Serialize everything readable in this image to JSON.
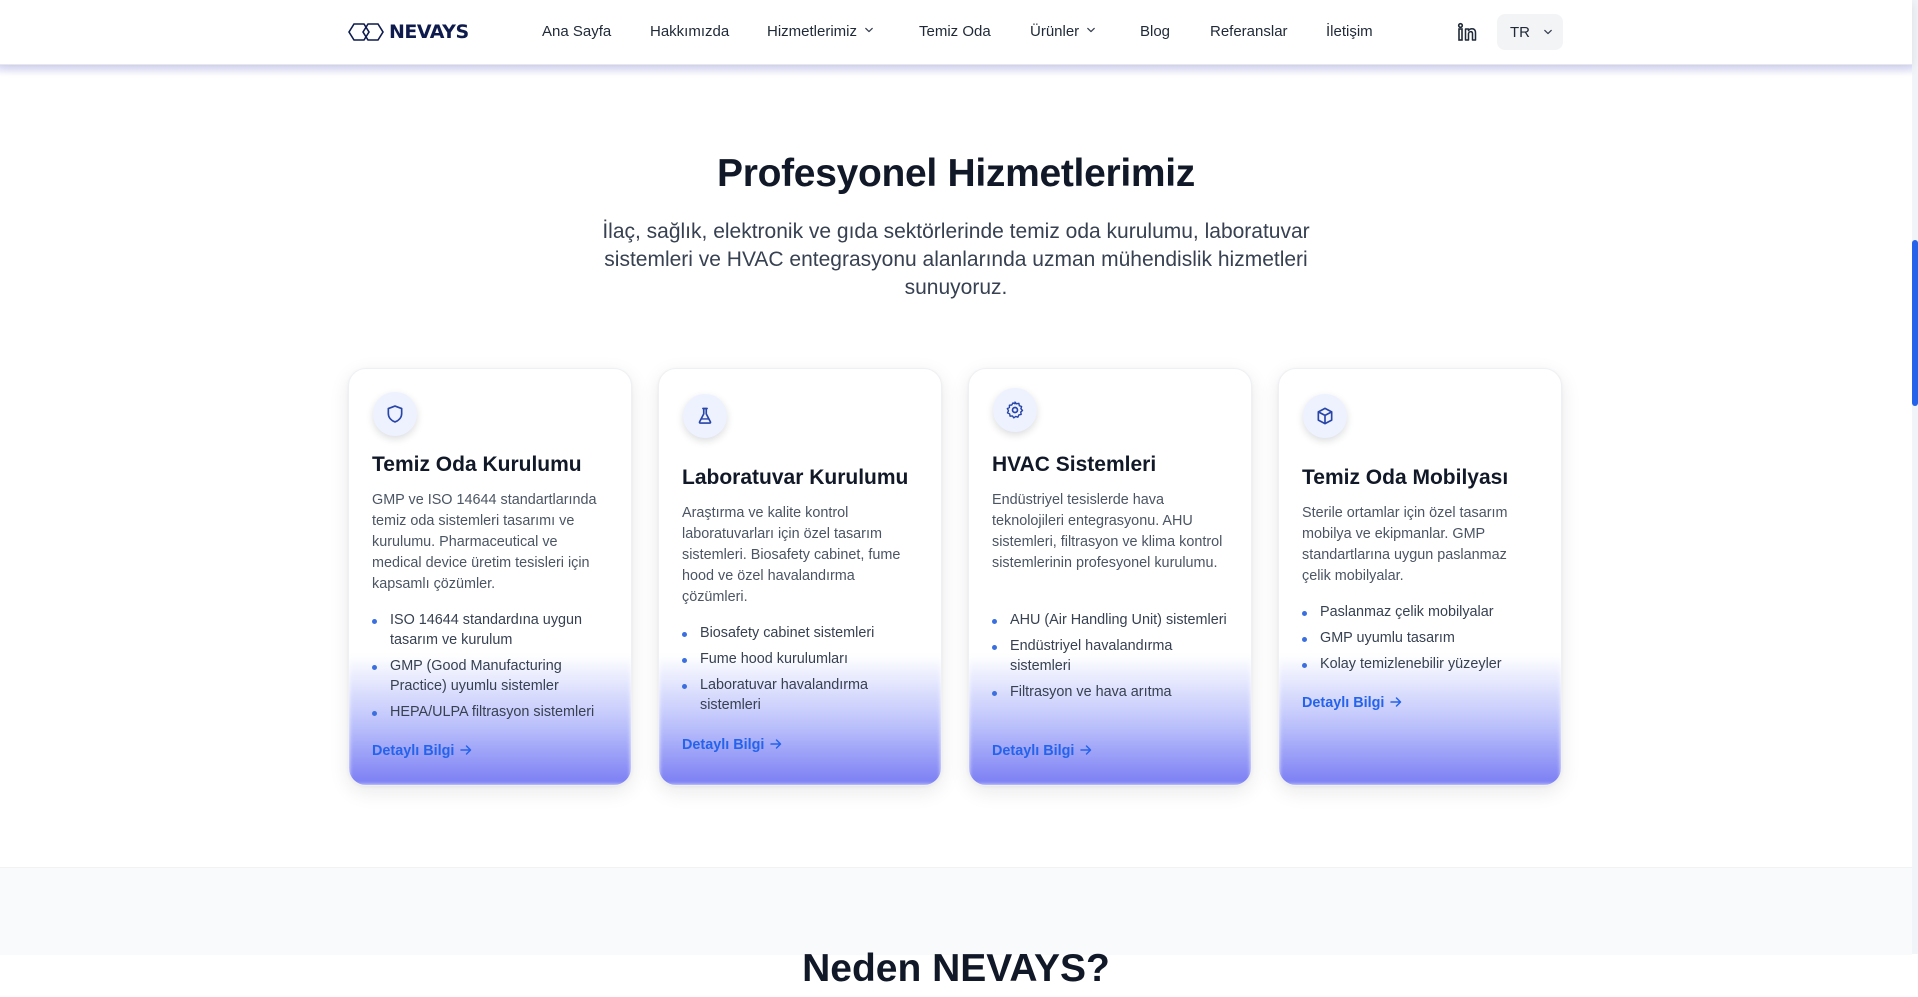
{
  "brand": {
    "logo_text": "NEVAYS"
  },
  "nav": {
    "items": [
      {
        "label": "Ana Sayfa"
      },
      {
        "label": "Hakkımızda"
      },
      {
        "label": "Hizmetlerimiz"
      },
      {
        "label": "Temiz Oda"
      },
      {
        "label": "Ürünler"
      },
      {
        "label": "Blog"
      },
      {
        "label": "Referanslar"
      },
      {
        "label": "İletişim"
      }
    ],
    "language": "TR"
  },
  "section": {
    "title": "Profesyonel Hizmetlerimiz",
    "subtitle": "İlaç, sağlık, elektronik ve gıda sektörlerinde temiz oda kurulumu, laboratuvar sistemleri ve HVAC entegrasyonu alanlarında uzman mühendislik hizmetleri sunuyoruz."
  },
  "cards": [
    {
      "icon": "shield-icon",
      "title": "Temiz Oda Kurulumu",
      "description": "GMP ve ISO 14644 standartlarında temiz oda sistemleri tasarımı ve kurulumu. Pharmaceutical ve medical device üretim tesisleri için kapsamlı çözümler.",
      "features": [
        "ISO 14644 standardına uygun tasarım ve kurulum",
        "GMP (Good Manufacturing Practice) uyumlu sistemler",
        "HEPA/ULPA filtrasyon sistemleri"
      ],
      "link": "Detaylı Bilgi"
    },
    {
      "icon": "flask-icon",
      "title": "Laboratuvar Kurulumu",
      "description": "Araştırma ve kalite kontrol laboratuvarları için özel tasarım sistemleri. Biosafety cabinet, fume hood ve özel havalandırma çözümleri.",
      "features": [
        "Biosafety cabinet sistemleri",
        "Fume hood kurulumları",
        "Laboratuvar havalandırma sistemleri"
      ],
      "link": "Detaylı Bilgi"
    },
    {
      "icon": "gear-icon",
      "title": "HVAC Sistemleri",
      "description": "Endüstriyel tesislerde hava teknolojileri entegrasyonu. AHU sistemleri, filtrasyon ve klima kontrol sistemlerinin profesyonel kurulumu.",
      "features": [
        "AHU (Air Handling Unit) sistemleri",
        "Endüstriyel havalandırma sistemleri",
        "Filtrasyon ve hava arıtma"
      ],
      "link": "Detaylı Bilgi"
    },
    {
      "icon": "cube-icon",
      "title": "Temiz Oda Mobilyası",
      "description": "Sterile ortamlar için özel tasarım mobilya ve ekipmanlar. GMP standartlarına uygun paslanmaz çelik mobilyalar.",
      "features": [
        "Paslanmaz çelik mobilyalar",
        "GMP uyumlu tasarım",
        "Kolay temizlenebilir yüzeyler"
      ],
      "link": "Detaylı Bilgi"
    }
  ],
  "next_section": {
    "title": "Neden NEVAYS?"
  },
  "colors": {
    "accent": "#2563eb",
    "brand_navy": "#0f1b4c",
    "card_glow": "#818cf8"
  }
}
